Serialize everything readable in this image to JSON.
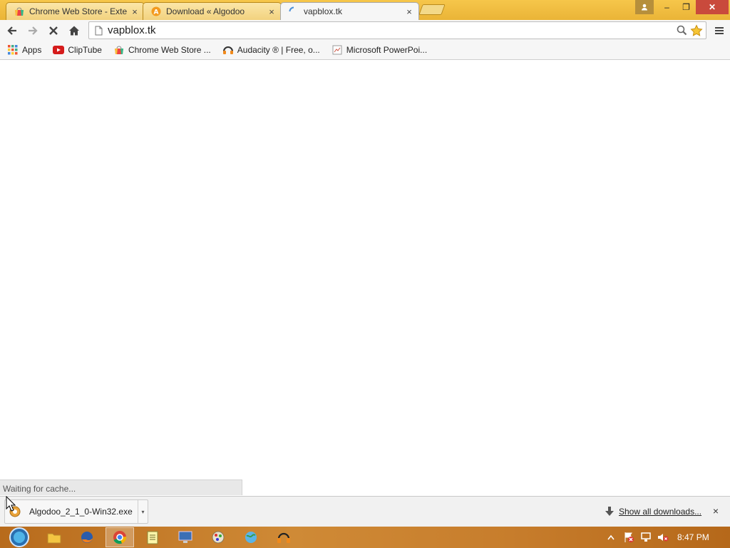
{
  "window": {
    "tabs": [
      {
        "title": "Chrome Web Store - Exte",
        "favicon": "chrome-web-store-icon",
        "active": false
      },
      {
        "title": "Download « Algodoo",
        "favicon": "algodoo-icon",
        "active": false
      },
      {
        "title": "vapblox.tk",
        "favicon": "loading-spinner-icon",
        "active": true
      }
    ],
    "tab_close": "×",
    "controls": {
      "minimize": "–",
      "restore": "❐",
      "close": "✕"
    }
  },
  "toolbar": {
    "url": "vapblox.tk",
    "icons": [
      "back-icon",
      "forward-icon",
      "stop-icon",
      "home-icon",
      "page-icon",
      "search-icon",
      "star-icon",
      "menu-icon"
    ]
  },
  "bookmarks": [
    {
      "label": "Apps",
      "icon": "apps-grid-icon"
    },
    {
      "label": "ClipTube",
      "icon": "youtube-icon"
    },
    {
      "label": "Chrome Web Store ...",
      "icon": "chrome-web-store-icon"
    },
    {
      "label": "Audacity ® | Free, o...",
      "icon": "audacity-icon"
    },
    {
      "label": "Microsoft PowerPoi...",
      "icon": "powerpoint-icon"
    }
  ],
  "status": {
    "text": "Waiting for cache..."
  },
  "downloads": {
    "file_name": "Algodoo_2_1_0-Win32.exe",
    "menu_arrow": "▾",
    "show_all": "Show all downloads...",
    "close": "×"
  },
  "taskbar": {
    "apps": [
      "file-explorer-icon",
      "firefox-icon",
      "chrome-icon",
      "notepad-icon",
      "remote-desktop-icon",
      "paint-icon",
      "globe-icon",
      "audacity-icon"
    ],
    "clock": "8:47 PM"
  },
  "colors": {
    "titlebar": "#eab437",
    "close_button": "#c94a3c",
    "taskbar": "#c77d2c",
    "toolbar": "#f6f6f6"
  }
}
